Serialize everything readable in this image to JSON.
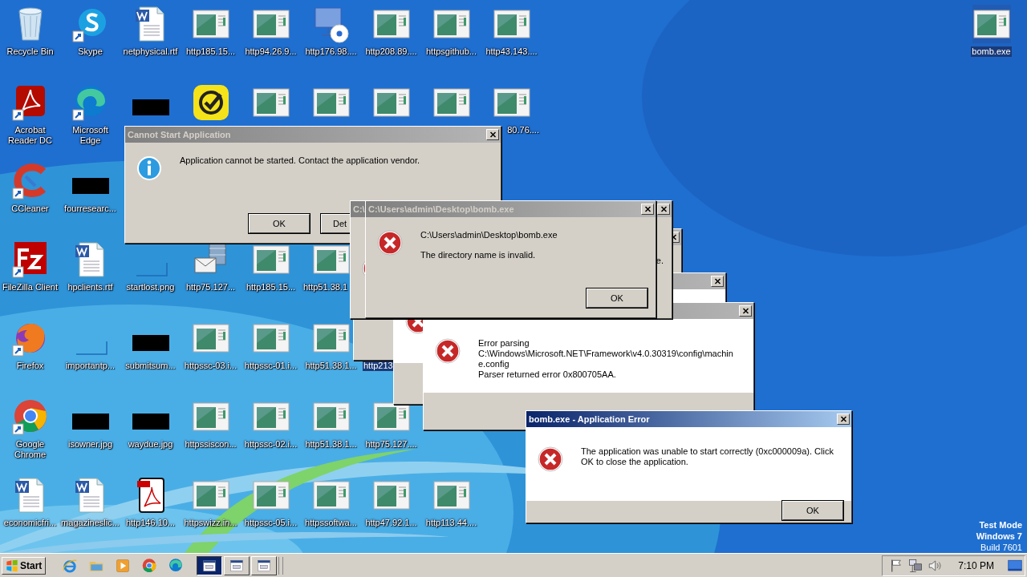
{
  "desktop": {
    "rows": [
      [
        {
          "label": "Recycle Bin",
          "kind": "recycle",
          "shortcut": false,
          "selected": false
        },
        {
          "label": "Skype",
          "kind": "skype",
          "shortcut": true,
          "selected": false
        },
        {
          "label": "netphysical.rtf",
          "kind": "word",
          "shortcut": false,
          "selected": false
        },
        {
          "label": "http185.15...",
          "kind": "web",
          "shortcut": false,
          "selected": false
        },
        {
          "label": "http94.26.9...",
          "kind": "web",
          "shortcut": false,
          "selected": false
        },
        {
          "label": "http176.98....",
          "kind": "monitor",
          "shortcut": false,
          "selected": false
        },
        {
          "label": "http208.89....",
          "kind": "web",
          "shortcut": false,
          "selected": false
        },
        {
          "label": "httpsgithub...",
          "kind": "web",
          "shortcut": false,
          "selected": false
        },
        {
          "label": "http43.143....",
          "kind": "web",
          "shortcut": false,
          "selected": false
        }
      ],
      [
        {
          "label": "Acrobat Reader DC",
          "kind": "acrobat",
          "shortcut": true,
          "selected": false
        },
        {
          "label": "Microsoft Edge",
          "kind": "edge",
          "shortcut": true,
          "selected": false
        },
        {
          "kind": "black",
          "shortcut": false,
          "selected": false
        },
        {
          "kind": "check",
          "shortcut": false,
          "selected": false
        },
        {
          "kind": "web",
          "shortcut": false,
          "selected": false
        },
        {
          "kind": "web",
          "shortcut": false,
          "selected": false
        },
        {
          "kind": "web",
          "shortcut": false,
          "selected": false
        },
        {
          "kind": "web",
          "shortcut": false,
          "selected": false
        },
        {
          "label": "80.76....",
          "kind": "web",
          "shortcut": false,
          "selected": false
        }
      ],
      [
        {
          "label": "CCleaner",
          "kind": "ccleaner",
          "shortcut": true,
          "selected": false
        },
        {
          "label": "fourresearc...",
          "kind": "black",
          "shortcut": false,
          "selected": false
        }
      ],
      [
        {
          "label": "FileZilla Client",
          "kind": "filezilla",
          "shortcut": true,
          "selected": false
        },
        {
          "label": "hpclients.rtf",
          "kind": "word",
          "shortcut": false,
          "selected": false
        },
        {
          "label": "startlost.png",
          "kind": "line",
          "shortcut": false,
          "selected": false
        },
        {
          "label": "http75.127...",
          "kind": "mail",
          "shortcut": false,
          "selected": false
        },
        {
          "label": "http185.15...",
          "kind": "web",
          "shortcut": false,
          "selected": false
        },
        {
          "label": "http51.38.1",
          "kind": "web",
          "shortcut": false,
          "selected": false
        }
      ],
      [
        {
          "label": "Firefox",
          "kind": "firefox",
          "shortcut": true,
          "selected": false
        },
        {
          "label": "importantp...",
          "kind": "line",
          "shortcut": false,
          "selected": false
        },
        {
          "label": "submitsum...",
          "kind": "black",
          "shortcut": false,
          "selected": false
        },
        {
          "label": "httpssc-03.i...",
          "kind": "web",
          "shortcut": false,
          "selected": false
        },
        {
          "label": "httpssc-01.i...",
          "kind": "web",
          "shortcut": false,
          "selected": false
        },
        {
          "label": "http51.38.1...",
          "kind": "web",
          "shortcut": false,
          "selected": false
        },
        {
          "label": "http213",
          "kind": "none",
          "selected": true
        }
      ],
      [
        {
          "label": "Google Chrome",
          "kind": "chrome",
          "shortcut": true,
          "selected": false
        },
        {
          "label": "isowner.jpg",
          "kind": "black",
          "shortcut": false,
          "selected": false
        },
        {
          "label": "waydue.jpg",
          "kind": "black",
          "shortcut": false,
          "selected": false
        },
        {
          "label": "httpssiscon...",
          "kind": "web",
          "shortcut": false,
          "selected": false
        },
        {
          "label": "httpssc-02.i...",
          "kind": "web",
          "shortcut": false,
          "selected": false
        },
        {
          "label": "http51.38.1...",
          "kind": "web",
          "shortcut": false,
          "selected": false
        },
        {
          "label": "http75.127....",
          "kind": "web",
          "shortcut": false,
          "selected": false
        }
      ],
      [
        {
          "label": "economicfri...",
          "kind": "word",
          "shortcut": false,
          "selected": false
        },
        {
          "label": "magazineslic...",
          "kind": "word",
          "shortcut": false,
          "selected": false
        },
        {
          "label": "http146.10...",
          "kind": "pdf",
          "shortcut": false,
          "selected": false
        },
        {
          "label": "httpswizz.in...",
          "kind": "web",
          "shortcut": false,
          "selected": false
        },
        {
          "label": "httpssc-05.i...",
          "kind": "web",
          "shortcut": false,
          "selected": false
        },
        {
          "label": "httpssoftwa...",
          "kind": "web",
          "shortcut": false,
          "selected": false
        },
        {
          "label": "http47.92.1...",
          "kind": "web",
          "shortcut": false,
          "selected": false
        },
        {
          "label": "http113.44....",
          "kind": "web",
          "shortcut": false,
          "selected": false
        }
      ]
    ],
    "corner_icon": {
      "label": "bomb.exe",
      "kind": "web",
      "shortcut": false,
      "selected": true
    }
  },
  "windows": [
    {
      "title": "Cannot Start Application",
      "active": false,
      "kind": "info",
      "message": [
        "Application cannot be started. Contact the application vendor."
      ],
      "buttons": [
        "OK",
        "Det"
      ]
    },
    {
      "kind": "plain",
      "active": false
    },
    {
      "kind": "error-white",
      "active": false
    },
    {
      "kind": "error-white",
      "active": false,
      "message": [
        "Error parsing",
        "C:\\Windows\\Microsoft.NET\\Framework\\v4.0.30319\\config\\machin",
        "e.config",
        "Parser returned error 0x800705AA."
      ]
    },
    {
      "title": "C:\\",
      "kind": "error-tail",
      "active": false,
      "message": [
        "e."
      ]
    },
    {
      "title": "C:\\Users\\admin\\Desktop\\bomb.exe",
      "kind": "error",
      "active": false,
      "message": [
        "C:\\Users\\admin\\Desktop\\bomb.exe",
        "The directory name is invalid."
      ],
      "buttons": [
        "OK"
      ]
    },
    {
      "title": "bomb.exe - Application Error",
      "kind": "error-white",
      "active": true,
      "message": [
        "The application was unable to start correctly (0xc000009a). Click",
        "OK to close the application."
      ],
      "buttons": [
        "OK"
      ]
    }
  ],
  "os_notice": [
    "Test Mode",
    "Windows 7",
    "Build 7601"
  ],
  "taskbar": {
    "start": "Start",
    "quick_launch": [
      {
        "kind": "ie"
      },
      {
        "kind": "folder"
      },
      {
        "kind": "media"
      },
      {
        "kind": "chrome"
      },
      {
        "kind": "edge"
      }
    ],
    "tasks": [
      {
        "selected": true
      },
      {
        "selected": false
      },
      {
        "selected": false
      }
    ],
    "tray": [
      {
        "kind": "flag"
      },
      {
        "kind": "network"
      },
      {
        "kind": "volume"
      }
    ],
    "clock": "7:10 PM"
  }
}
